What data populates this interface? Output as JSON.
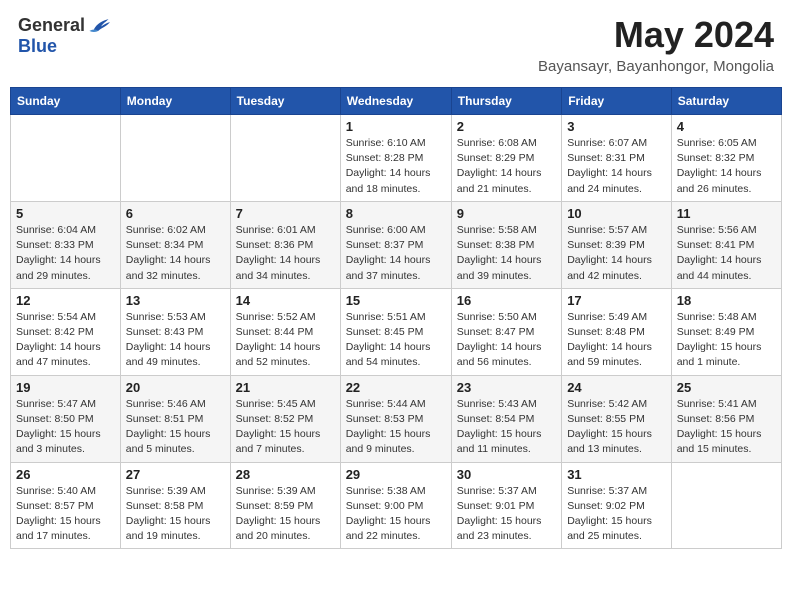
{
  "header": {
    "logo_general": "General",
    "logo_blue": "Blue",
    "title": "May 2024",
    "location": "Bayansayr, Bayanhongor, Mongolia"
  },
  "weekdays": [
    "Sunday",
    "Monday",
    "Tuesday",
    "Wednesday",
    "Thursday",
    "Friday",
    "Saturday"
  ],
  "weeks": [
    [
      {
        "day": "",
        "info": ""
      },
      {
        "day": "",
        "info": ""
      },
      {
        "day": "",
        "info": ""
      },
      {
        "day": "1",
        "info": "Sunrise: 6:10 AM\nSunset: 8:28 PM\nDaylight: 14 hours and 18 minutes."
      },
      {
        "day": "2",
        "info": "Sunrise: 6:08 AM\nSunset: 8:29 PM\nDaylight: 14 hours and 21 minutes."
      },
      {
        "day": "3",
        "info": "Sunrise: 6:07 AM\nSunset: 8:31 PM\nDaylight: 14 hours and 24 minutes."
      },
      {
        "day": "4",
        "info": "Sunrise: 6:05 AM\nSunset: 8:32 PM\nDaylight: 14 hours and 26 minutes."
      }
    ],
    [
      {
        "day": "5",
        "info": "Sunrise: 6:04 AM\nSunset: 8:33 PM\nDaylight: 14 hours and 29 minutes."
      },
      {
        "day": "6",
        "info": "Sunrise: 6:02 AM\nSunset: 8:34 PM\nDaylight: 14 hours and 32 minutes."
      },
      {
        "day": "7",
        "info": "Sunrise: 6:01 AM\nSunset: 8:36 PM\nDaylight: 14 hours and 34 minutes."
      },
      {
        "day": "8",
        "info": "Sunrise: 6:00 AM\nSunset: 8:37 PM\nDaylight: 14 hours and 37 minutes."
      },
      {
        "day": "9",
        "info": "Sunrise: 5:58 AM\nSunset: 8:38 PM\nDaylight: 14 hours and 39 minutes."
      },
      {
        "day": "10",
        "info": "Sunrise: 5:57 AM\nSunset: 8:39 PM\nDaylight: 14 hours and 42 minutes."
      },
      {
        "day": "11",
        "info": "Sunrise: 5:56 AM\nSunset: 8:41 PM\nDaylight: 14 hours and 44 minutes."
      }
    ],
    [
      {
        "day": "12",
        "info": "Sunrise: 5:54 AM\nSunset: 8:42 PM\nDaylight: 14 hours and 47 minutes."
      },
      {
        "day": "13",
        "info": "Sunrise: 5:53 AM\nSunset: 8:43 PM\nDaylight: 14 hours and 49 minutes."
      },
      {
        "day": "14",
        "info": "Sunrise: 5:52 AM\nSunset: 8:44 PM\nDaylight: 14 hours and 52 minutes."
      },
      {
        "day": "15",
        "info": "Sunrise: 5:51 AM\nSunset: 8:45 PM\nDaylight: 14 hours and 54 minutes."
      },
      {
        "day": "16",
        "info": "Sunrise: 5:50 AM\nSunset: 8:47 PM\nDaylight: 14 hours and 56 minutes."
      },
      {
        "day": "17",
        "info": "Sunrise: 5:49 AM\nSunset: 8:48 PM\nDaylight: 14 hours and 59 minutes."
      },
      {
        "day": "18",
        "info": "Sunrise: 5:48 AM\nSunset: 8:49 PM\nDaylight: 15 hours and 1 minute."
      }
    ],
    [
      {
        "day": "19",
        "info": "Sunrise: 5:47 AM\nSunset: 8:50 PM\nDaylight: 15 hours and 3 minutes."
      },
      {
        "day": "20",
        "info": "Sunrise: 5:46 AM\nSunset: 8:51 PM\nDaylight: 15 hours and 5 minutes."
      },
      {
        "day": "21",
        "info": "Sunrise: 5:45 AM\nSunset: 8:52 PM\nDaylight: 15 hours and 7 minutes."
      },
      {
        "day": "22",
        "info": "Sunrise: 5:44 AM\nSunset: 8:53 PM\nDaylight: 15 hours and 9 minutes."
      },
      {
        "day": "23",
        "info": "Sunrise: 5:43 AM\nSunset: 8:54 PM\nDaylight: 15 hours and 11 minutes."
      },
      {
        "day": "24",
        "info": "Sunrise: 5:42 AM\nSunset: 8:55 PM\nDaylight: 15 hours and 13 minutes."
      },
      {
        "day": "25",
        "info": "Sunrise: 5:41 AM\nSunset: 8:56 PM\nDaylight: 15 hours and 15 minutes."
      }
    ],
    [
      {
        "day": "26",
        "info": "Sunrise: 5:40 AM\nSunset: 8:57 PM\nDaylight: 15 hours and 17 minutes."
      },
      {
        "day": "27",
        "info": "Sunrise: 5:39 AM\nSunset: 8:58 PM\nDaylight: 15 hours and 19 minutes."
      },
      {
        "day": "28",
        "info": "Sunrise: 5:39 AM\nSunset: 8:59 PM\nDaylight: 15 hours and 20 minutes."
      },
      {
        "day": "29",
        "info": "Sunrise: 5:38 AM\nSunset: 9:00 PM\nDaylight: 15 hours and 22 minutes."
      },
      {
        "day": "30",
        "info": "Sunrise: 5:37 AM\nSunset: 9:01 PM\nDaylight: 15 hours and 23 minutes."
      },
      {
        "day": "31",
        "info": "Sunrise: 5:37 AM\nSunset: 9:02 PM\nDaylight: 15 hours and 25 minutes."
      },
      {
        "day": "",
        "info": ""
      }
    ]
  ]
}
